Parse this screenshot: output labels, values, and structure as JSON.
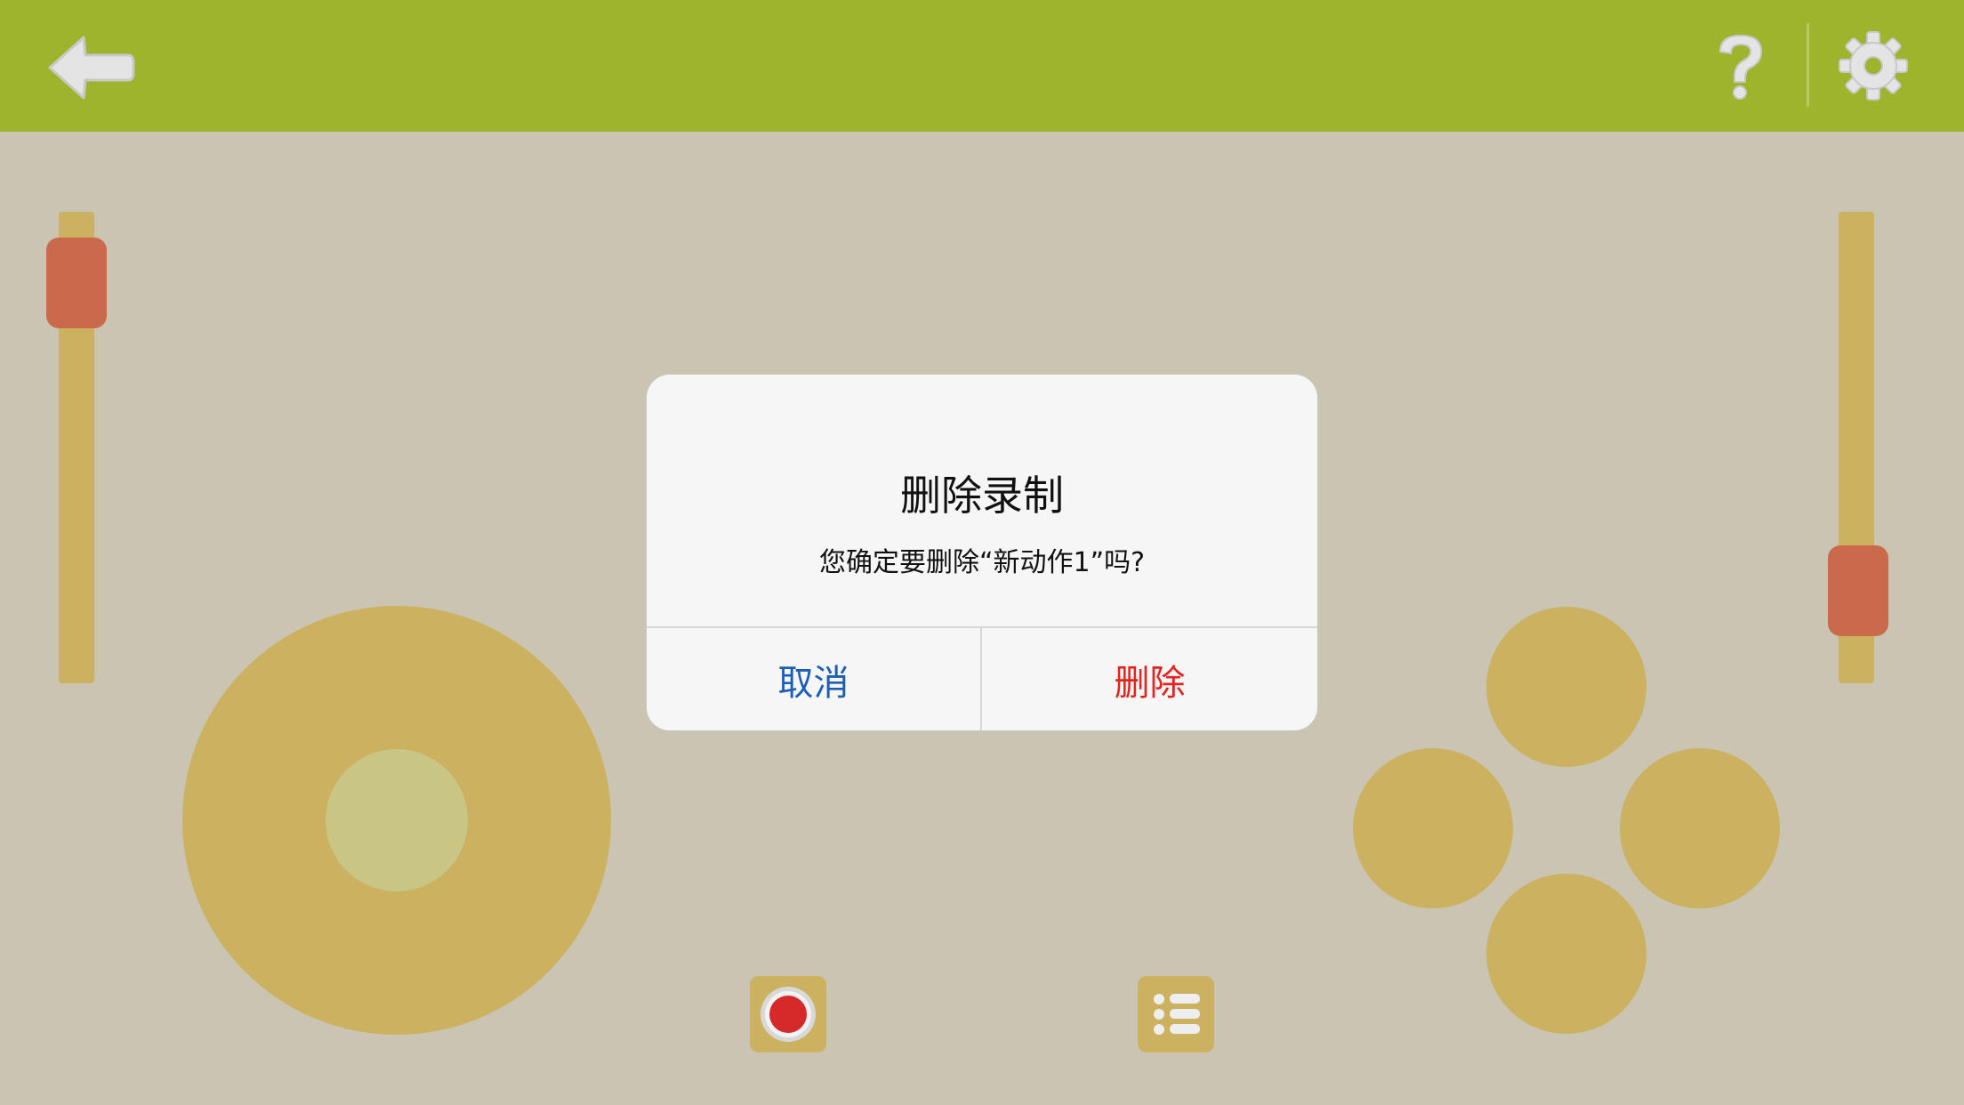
{
  "toolbar": {
    "back_icon": "back-arrow-icon",
    "help_icon": "question-mark-icon",
    "settings_icon": "gear-icon",
    "bar_color": "#9fb42d"
  },
  "controls": {
    "left_slider_level": 0.91,
    "right_slider_level": 0.1,
    "slider_track_color": "#cbb160",
    "slider_thumb_color": "#cb6a4b",
    "joystick_color": "#cbb160",
    "record_icon": "record-icon",
    "list_icon": "list-icon"
  },
  "dialog": {
    "title": "删除录制",
    "message": "您确定要删除“新动作1”吗?",
    "cancel_label": "取消",
    "delete_label": "删除",
    "cancel_color": "#1d5fb4",
    "delete_color": "#e3231d"
  }
}
